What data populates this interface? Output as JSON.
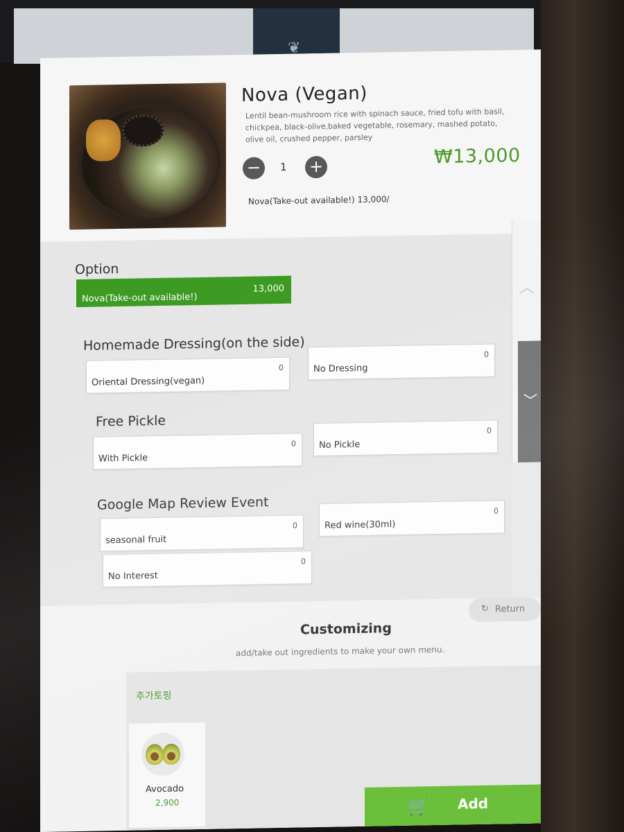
{
  "product": {
    "title": "Nova (Vegan)",
    "description": "Lentil bean-mushroom rice with spinach sauce, fried tofu with basil, chickpea, black-olive,baked vegetable, rosemary, mashed potato, olive oil, crushed pepper, parsley",
    "quantity": "1",
    "minus_symbol": "−",
    "plus_symbol": "+",
    "price": "₩13,000",
    "summary": "Nova(Take-out available!) 13,000/"
  },
  "options": {
    "heading": "Option",
    "selected": {
      "label": "Nova(Take-out available!)",
      "amount": "13,000"
    },
    "groups": [
      {
        "heading": "Homemade Dressing(on the side)",
        "choices": [
          {
            "label": "Oriental Dressing(vegan)",
            "amount": "0"
          },
          {
            "label": "No Dressing",
            "amount": "0"
          }
        ]
      },
      {
        "heading": "Free Pickle",
        "choices": [
          {
            "label": "With Pickle",
            "amount": "0"
          },
          {
            "label": "No Pickle",
            "amount": "0"
          }
        ]
      },
      {
        "heading": "Google Map Review Event",
        "choices": [
          {
            "label": "seasonal fruit",
            "amount": "0"
          },
          {
            "label": "Red wine(30ml)",
            "amount": "0"
          },
          {
            "label": "No Interest",
            "amount": "0"
          }
        ]
      }
    ]
  },
  "scroll": {
    "up_icon": "chevron-up-icon",
    "down_icon": "chevron-down-icon"
  },
  "customizing": {
    "return_label": "Return",
    "title": "Customizing",
    "subtitle": "add/take out ingredients to make your own menu.",
    "topping_section": "추가토핑",
    "toppings": [
      {
        "name": "Avocado",
        "price": "2,900"
      }
    ],
    "add_label": "Add"
  },
  "colors": {
    "accent_green": "#3d9a22",
    "price_green": "#4a9a2a",
    "add_green": "#6cbf3a"
  }
}
